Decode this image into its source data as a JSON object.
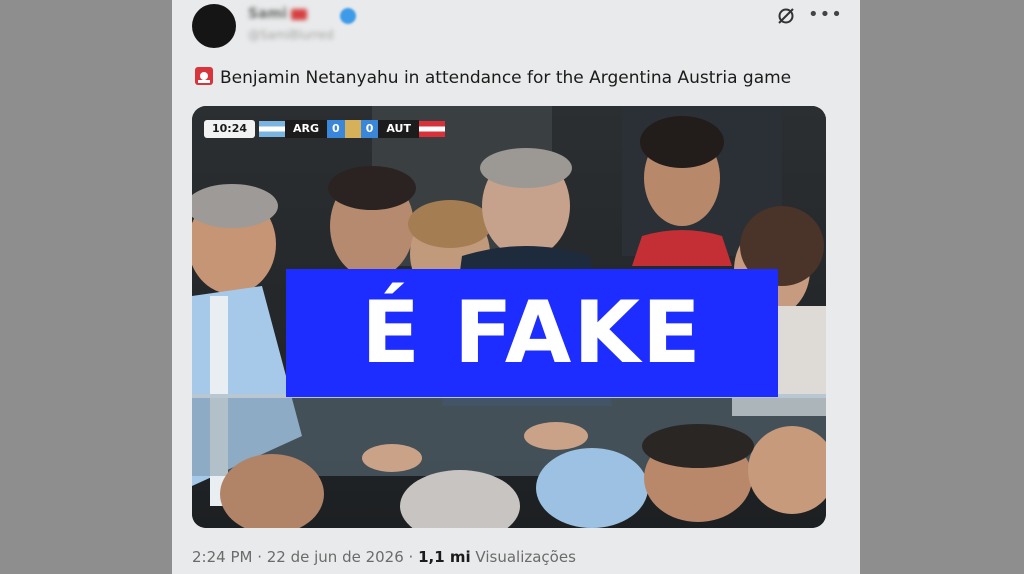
{
  "author": {
    "name": "Sami",
    "handle": "@SamiBlurred"
  },
  "icons": {
    "grok": "grok-icon",
    "more": "more-icon",
    "siren": "siren-emoji-icon",
    "verified": "verified-badge-icon"
  },
  "tweet": {
    "text": "Benjamin Netanyahu in attendance for the Argentina Austria game"
  },
  "scoreboard": {
    "time": "10:24",
    "home": "ARG",
    "home_score": "0",
    "away_score": "0",
    "away": "AUT"
  },
  "overlay": {
    "label": "É FAKE"
  },
  "footer": {
    "time": "2:24 PM · 22 de jun de 2026 · ",
    "views": "1,1 mi",
    "views_label": " Visualizações"
  },
  "colors": {
    "banner": "#1e2dff",
    "page_bg": "#8e8e8e",
    "card_bg": "#e9eaeb",
    "verified": "#3d9be9"
  }
}
